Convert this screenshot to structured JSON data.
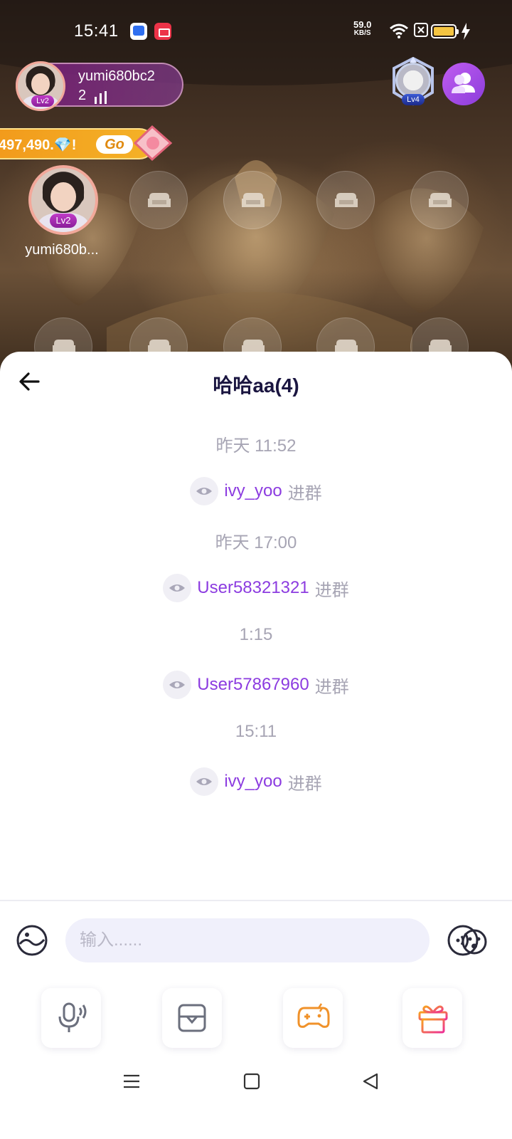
{
  "status_bar": {
    "time": "15:41",
    "net_speed_value": "59.0",
    "net_speed_unit": "KB/S",
    "battery_color": "#f5c542"
  },
  "host": {
    "name": "yumi680bc2",
    "count": "2",
    "level": "Lv2"
  },
  "room_badge": {
    "level": "Lv4"
  },
  "banner": {
    "text": "497,490.💎!",
    "go_label": "Go"
  },
  "seats": {
    "occupied": {
      "name": "yumi680b...",
      "level": "Lv2"
    },
    "empty_icon": "sofa-icon"
  },
  "chat": {
    "title": "哈哈aa(4)",
    "messages": [
      {
        "type": "time",
        "text": "昨天 11:52"
      },
      {
        "type": "join",
        "user": "ivy_yoo",
        "action": "进群"
      },
      {
        "type": "time",
        "text": "昨天 17:00"
      },
      {
        "type": "join",
        "user": "User58321321",
        "action": "进群"
      },
      {
        "type": "time",
        "text": "1:15"
      },
      {
        "type": "join",
        "user": "User57867960",
        "action": "进群"
      },
      {
        "type": "time",
        "text": "15:11"
      },
      {
        "type": "join",
        "user": "ivy_yoo",
        "action": "进群"
      }
    ]
  },
  "input": {
    "placeholder": "输入......"
  },
  "toolbar": {
    "icons": [
      "mic-icon",
      "album-icon",
      "game-controller-icon",
      "gift-icon"
    ]
  },
  "colors": {
    "accent_purple": "#8c3ce0",
    "title_dark": "#1a1540",
    "muted_gray": "#a7a5b4",
    "game_orange": "#f0922a",
    "gift_pink": "#f0398a"
  }
}
